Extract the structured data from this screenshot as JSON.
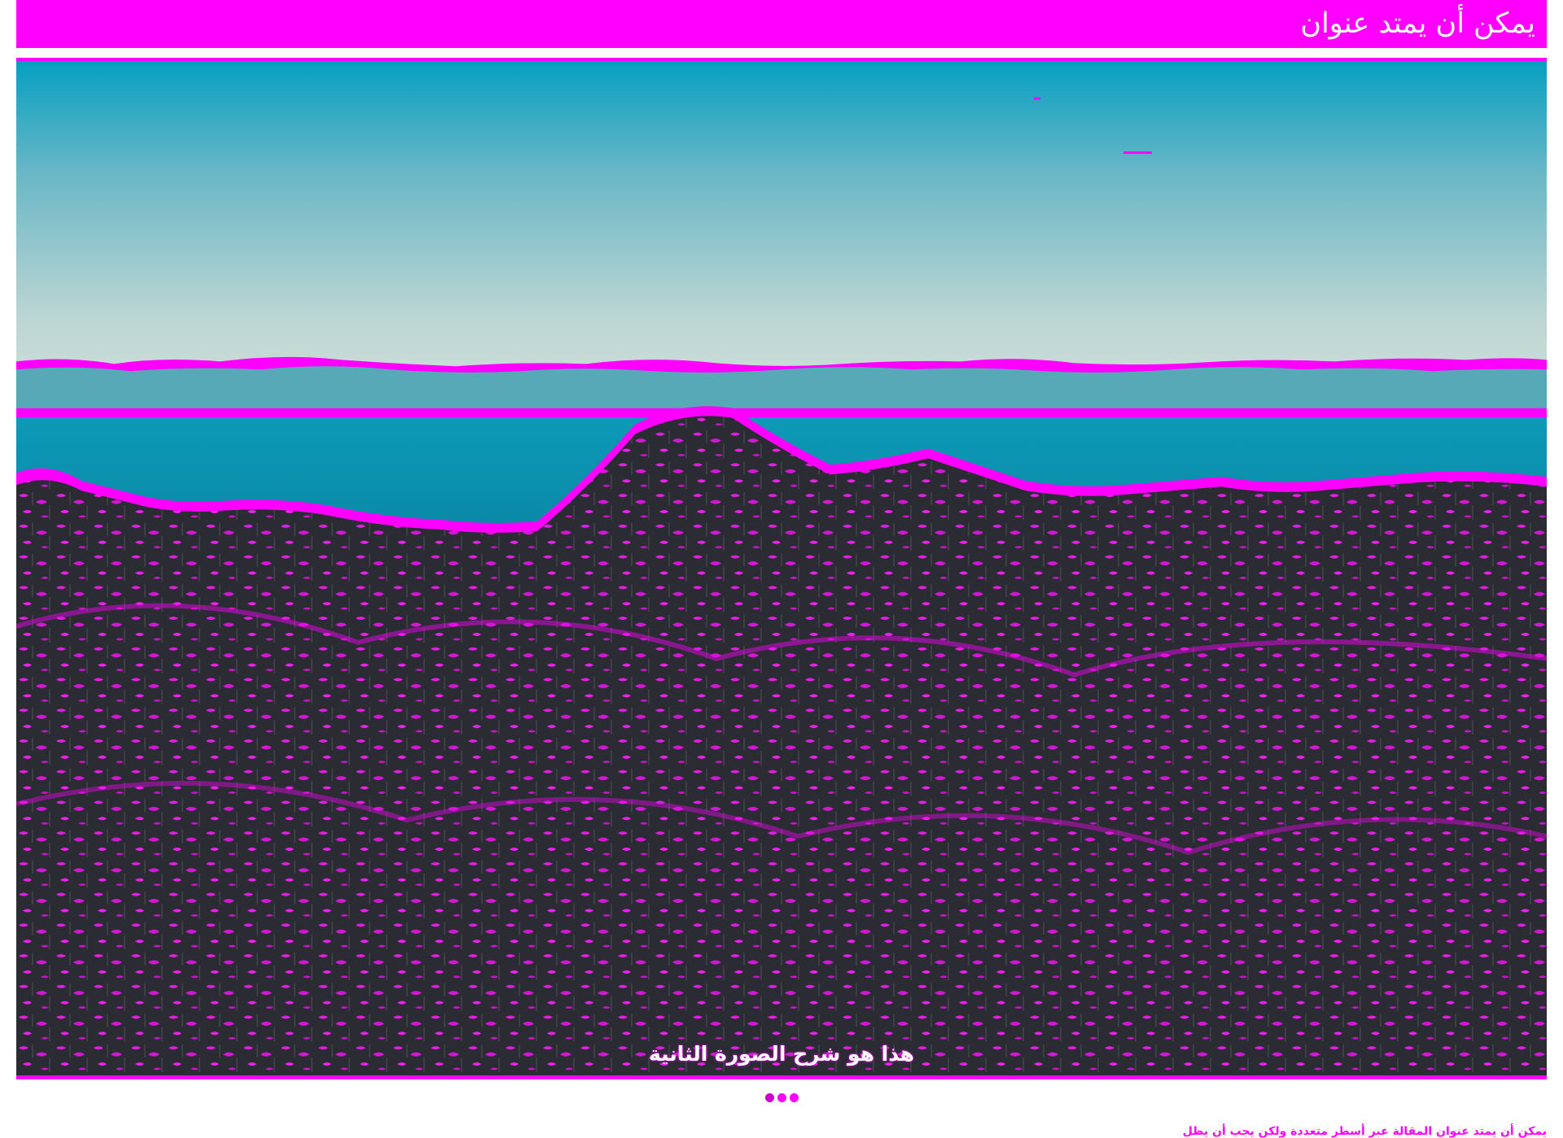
{
  "header": {
    "title": "يمكن أن يمتد عنوان"
  },
  "slider": {
    "image_icon": "landscape-photo",
    "caption": "هذا هو شرح الصورة الثانية",
    "dots_count": 3,
    "active_index": 0
  },
  "excerpt": {
    "text": "يمكن أن يمتد عنوان المقالة عبر أسطر متعددة ولكن يجب أن يظل"
  },
  "colors": {
    "accent": "#ff00ff",
    "sky_top": "#0aa2c2",
    "sky_horizon": "#cddfd8",
    "water": "#0fa4c0",
    "vegetation": "#262830"
  }
}
